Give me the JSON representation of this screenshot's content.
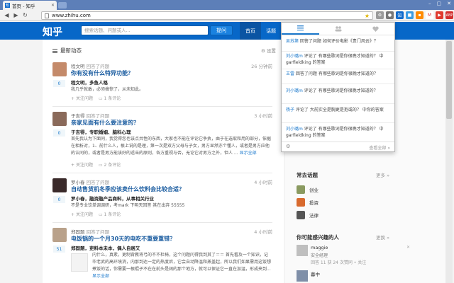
{
  "browser": {
    "tab_title": "首页 - 知乎",
    "tab_favicon": "知",
    "url": "www.zhihu.com",
    "win_min": "–",
    "win_max": "▢",
    "win_close": "✕"
  },
  "header": {
    "logo": "知乎",
    "search_placeholder": "搜索话题、问题或人...",
    "ask_button": "提问",
    "nav_home": "首页",
    "nav_topics": "话题"
  },
  "feed": {
    "heading": "最新动态",
    "settings": "设置",
    "items": [
      {
        "meta_who": "程文明",
        "meta_action": "回答了问题",
        "time": "26 分钟前",
        "title": "你有没有什么特异功能？",
        "author": "程文明，多鱼人格",
        "excerpt": "我几乎就敢，必须搞惊了，从未知此。",
        "votes": "0",
        "follow": "关注问题",
        "comment": "1 条评论"
      },
      {
        "meta_who": "于吉得",
        "meta_action": "回答了问题",
        "time": "3 小时前",
        "title": "亲家见面有什么要注意的？",
        "author": "于吉得，专职婚姻、脑科心理",
        "excerpt": "首先我认为下面同，我觉得您也该点共性的东西，大家也不能在评论它争执，由于在选取和用的部分，依据在相析对，1、前什么人，根上说的是理，第一次是双方父母与子女，男方显然亦个懂人，或者是男方应他的认同的，或者是男方能该好的适当的原则，各方重视与否，无论它对男方之外，但人 ...",
        "more": "显示全部",
        "votes": "0",
        "follow": "关注问题",
        "comment": "2 条评论"
      },
      {
        "meta_who": "罗小春",
        "meta_action": "回答了问题",
        "time": "4 小时前",
        "title": "自动售货机冬季应该卖什么饮料会比较合适？",
        "author": "罗小春，融资融产品商料，从事相关行业",
        "excerpt": "不是专业饮单调调研，考mark 下明天回答 其在出弃 55555",
        "votes": "0",
        "follow": "关注问题",
        "comment": "1 条评论"
      },
      {
        "meta_who": "郑固题",
        "meta_action": "回答了问题",
        "time": "4 小时前",
        "title": "电饭锅的一个月30天的电吃不重要重错？",
        "author": "郑固题，吏料本未本，偶人自居又",
        "excerpt": "内什么，真素，更制背教将弓的不不杜椅，这个问题问得我到其了＝＝ 首先看及一个知识，记毕老武的高环境消，内那到达一定的热度后，它会自动降温和蒸盖起，所以我们如果需用这饭想煮饭的话，你需要一根棍子不在在前头是阔的那个地方，就可以保证它一直在加温，形成夹到...",
        "more": "显示全部",
        "votes": "51",
        "follow": "关注问题",
        "comment": "1 条评论"
      }
    ]
  },
  "popup": {
    "notifications": [
      {
        "who": "吴苏第",
        "text": " 回答了问题 如何评价电影《贵门风云》？"
      },
      {
        "who": "刘小璐m",
        "text": " 评论了 有哪些歌词是你很晚才知道的？ 中 garfieldking 的答案"
      },
      {
        "who": "王雷",
        "text": " 回答了问题 有哪些歌词是你很晚才知道的？"
      },
      {
        "who": "刘小璐m",
        "text": " 评论了 有哪些歌词是你很晚才知道的？"
      },
      {
        "who": "杨子",
        "text": " 评论了 大前实全是胸更是抱或的？ 中你的答案"
      },
      {
        "who": "刘小璐m",
        "text": " 评论了 有哪些歌词是你很晚才知道的？ 中 garfieldking 的答案"
      }
    ],
    "see_all": "查看全部 »"
  },
  "sidebar": {
    "topics_title": "常去话题",
    "topics_more": "更多 »",
    "topics": [
      {
        "name": "创业",
        "color": "#8a9a60"
      },
      {
        "name": "投资",
        "color": "#d86a2e"
      },
      {
        "name": "法律",
        "color": "#555555"
      }
    ],
    "people_title": "你可能感兴趣的人",
    "people_more": "更换 »",
    "people": [
      {
        "name": "maggie",
        "desc": "安全经理",
        "stats": "回答 11  获 24 次赞同 • 关注"
      },
      {
        "name": "暮中",
        "desc": "",
        "stats": ""
      }
    ]
  },
  "icons": {
    "back": "back-arrow-icon",
    "forward": "forward-arrow-icon",
    "reload": "reload-icon",
    "star": "star-icon"
  }
}
